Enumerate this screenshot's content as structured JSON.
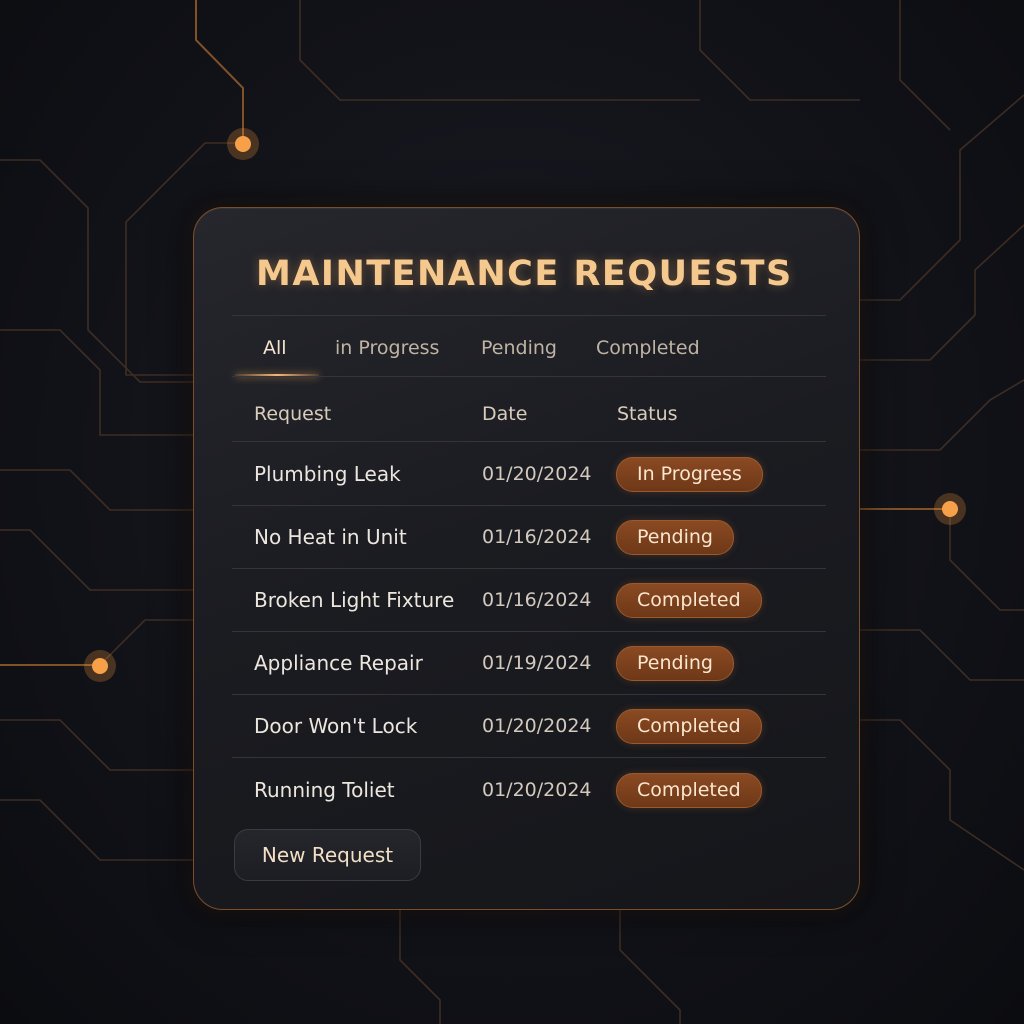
{
  "title": "MAINTENANCE REQUESTS",
  "tabs": [
    {
      "label": "All",
      "active": true
    },
    {
      "label": "in Progress",
      "active": false
    },
    {
      "label": "Pending",
      "active": false
    },
    {
      "label": "Completed",
      "active": false
    }
  ],
  "table": {
    "headers": {
      "request": "Request",
      "date": "Date",
      "status": "Status"
    },
    "rows": [
      {
        "request": "Plumbing Leak",
        "date": "01/20/2024",
        "status": "In Progress"
      },
      {
        "request": "No Heat in Unit",
        "date": "01/16/2024",
        "status": "Pending"
      },
      {
        "request": "Broken Light Fixture",
        "date": "01/16/2024",
        "status": "Completed"
      },
      {
        "request": "Appliance Repair",
        "date": "01/19/2024",
        "status": "Pending"
      },
      {
        "request": "Door Won't Lock",
        "date": "01/20/2024",
        "status": "Completed"
      },
      {
        "request": "Running Toliet",
        "date": "01/20/2024",
        "status": "Completed"
      }
    ]
  },
  "actions": {
    "new_request_label": "New Request"
  },
  "colors": {
    "accent": "#f5c98e",
    "badge": "#7a3f1c",
    "glow": "#f0a05a",
    "background": "#121319"
  }
}
